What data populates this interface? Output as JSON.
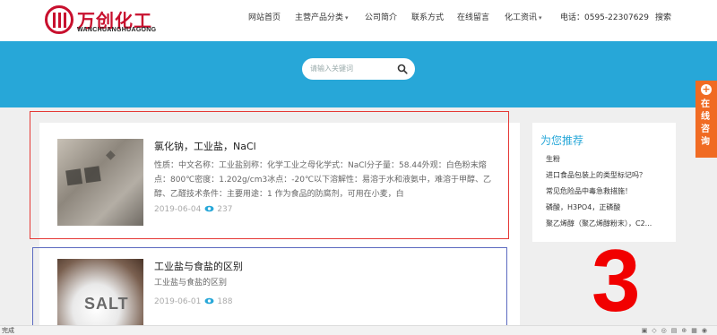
{
  "brand": {
    "name_cn": "万创化工",
    "name_en": "WANCHUANGHUAGONG"
  },
  "nav": {
    "home": "网站首页",
    "products": "主营产品分类",
    "about": "公司简介",
    "contact": "联系方式",
    "message": "在线留言",
    "news": "化工资讯",
    "phone": "电话：0595-22307629",
    "search": "搜索"
  },
  "search": {
    "placeholder": "请输入关键词"
  },
  "articles": [
    {
      "title": "氯化钠，工业盐，NaCl",
      "desc": "性质：中文名称：工业盐别称：化学工业之母化学式：NaCl分子量：58.44外观：白色粉末熔点：800℃密度：1.202g/cm3冰点：-20℃以下溶解性：易溶于水和液氨中，难溶于甲醇、乙醇、乙醛技术条件：主要用途：1 作为食品的防腐剂，可用在小麦，白",
      "date": "2019-06-04",
      "views": "237"
    },
    {
      "title": "工业盐与食盐的区别",
      "desc": "工业盐与食盐的区别",
      "date": "2019-06-01",
      "views": "188"
    }
  ],
  "sidebar": {
    "title": "为您推荐",
    "items": [
      "生粉",
      "进口食品包装上的类型标记吗？",
      "常见危险品中毒急救措施！",
      "磷酸，H3PO4，正磷酸",
      "聚乙烯醇（聚乙烯醇粉末），C2..."
    ]
  },
  "consult": {
    "label": "在线咨询"
  },
  "overlay_number": "3",
  "statusbar": {
    "left": "完成"
  },
  "colors": {
    "brand_red": "#c8102e",
    "banner_blue": "#27a7d8",
    "consult_orange": "#f06b23"
  }
}
